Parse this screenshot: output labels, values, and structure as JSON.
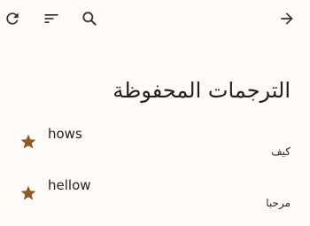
{
  "toolbar": {
    "icons": [
      "refresh-icon",
      "sort-icon",
      "search-icon",
      "arrow-forward-icon"
    ]
  },
  "page": {
    "title": "الترجمات المحفوظة"
  },
  "saved_translations": [
    {
      "source": "hows",
      "translation": "كيف",
      "starred": true
    },
    {
      "source": "hellow",
      "translation": "مرحبا",
      "starred": true
    }
  ],
  "colors": {
    "background": "#fefaf5",
    "star": "#8a5a2b",
    "icon": "#333333"
  }
}
